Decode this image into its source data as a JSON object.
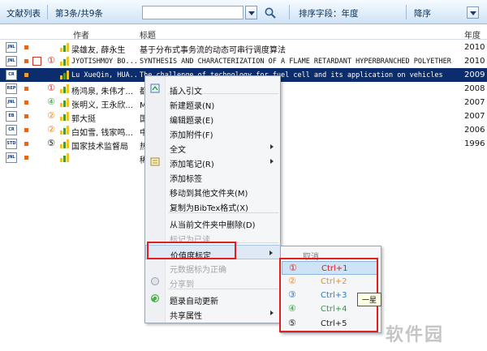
{
  "toolbar": {
    "title": "文献列表",
    "count": "第3条/共9条",
    "sort_label": "排序字段：年度",
    "sort_order": "降序"
  },
  "columns": {
    "author": "作者",
    "title": "标题",
    "year": "年度"
  },
  "rows": [
    {
      "type": "JNL",
      "author": "梁雄友, 薛永生",
      "title": "基于分布式事务流的动态可串行调度算法",
      "year": "2010",
      "rating": "",
      "pdf": false,
      "mono": false
    },
    {
      "type": "JNL",
      "author": "JYOTISHMOY BO...",
      "title": "SYNTHESIS AND CHARACTERIZATION OF A FLAME RETARDANT HYPERBRANCHED POLYETHER",
      "year": "2010",
      "rating": "①",
      "pdf": true,
      "mono": true
    },
    {
      "type": "CR",
      "author": "Lu XueQin, HUA...",
      "title": "The challenge of technology for fuel cell and its application on vehicles",
      "year": "2009",
      "rating": "",
      "pdf": false,
      "mono": true
    },
    {
      "type": "REP",
      "author": "杨鸿泉, 朱伟才...",
      "title": "都...",
      "year": "2008",
      "rating": "①",
      "pdf": false,
      "mono": false
    },
    {
      "type": "JNL",
      "author": "张明义, 王永欣...",
      "title": "Mi...                                                   场模拟",
      "year": "2007",
      "rating": "④",
      "pdf": false,
      "mono": false
    },
    {
      "type": "EB",
      "author": "郭大挺",
      "title": "国...                                                   析研究",
      "year": "2007",
      "rating": "②",
      "pdf": false,
      "mono": false
    },
    {
      "type": "CR",
      "author": "白如雪, 钱家鸣...",
      "title": "中...                                                   与机制的研究",
      "year": "2006",
      "rating": "②",
      "pdf": false,
      "mono": false
    },
    {
      "type": "STD",
      "author": "国家技术监督局",
      "title": "热...",
      "year": "1996",
      "rating": "⑤",
      "pdf": false,
      "mono": false
    },
    {
      "type": "JNL",
      "author": "",
      "title": "稀...",
      "year": "",
      "rating": "",
      "pdf": false,
      "mono": false
    }
  ],
  "context_menu": {
    "items": [
      {
        "label": "插入引文",
        "disabled": false,
        "submenu": false,
        "icon": "quote-icon"
      },
      {
        "label": "新建题录(N)",
        "disabled": false,
        "submenu": false,
        "icon": ""
      },
      {
        "label": "编辑题录(E)",
        "disabled": false,
        "submenu": false,
        "icon": ""
      },
      {
        "label": "添加附件(F)",
        "disabled": false,
        "submenu": false,
        "icon": ""
      },
      {
        "label": "全文",
        "disabled": false,
        "submenu": true,
        "icon": ""
      },
      {
        "label": "添加笔记(R)",
        "disabled": false,
        "submenu": true,
        "icon": "note-icon"
      },
      {
        "label": "添加标签",
        "disabled": false,
        "submenu": false,
        "icon": ""
      },
      {
        "label": "移动到其他文件夹(M)",
        "disabled": false,
        "submenu": false,
        "icon": ""
      },
      {
        "label": "复制为BibTex格式(X)",
        "disabled": false,
        "submenu": false,
        "icon": ""
      },
      {
        "label": "从当前文件夹中删除(D)",
        "disabled": false,
        "submenu": false,
        "icon": ""
      },
      {
        "label": "标记为已读",
        "disabled": true,
        "submenu": false,
        "icon": ""
      },
      {
        "label": "价值度标定",
        "disabled": false,
        "submenu": true,
        "icon": ""
      },
      {
        "label": "元数据标为正确",
        "disabled": true,
        "submenu": false,
        "icon": ""
      },
      {
        "label": "分享到",
        "disabled": true,
        "submenu": false,
        "icon": "share-icon"
      },
      {
        "label": "题录自动更新",
        "disabled": false,
        "submenu": false,
        "icon": "refresh-icon"
      },
      {
        "label": "共享属性",
        "disabled": false,
        "submenu": true,
        "icon": ""
      }
    ]
  },
  "rating_submenu": {
    "cancel": "取消",
    "items": [
      {
        "symbol": "①",
        "shortcut": "Ctrl+1",
        "color": "#d11f1f"
      },
      {
        "symbol": "②",
        "shortcut": "Ctrl+2",
        "color": "#e8892b"
      },
      {
        "symbol": "③",
        "shortcut": "Ctrl+3",
        "color": "#2f78c4"
      },
      {
        "symbol": "④",
        "shortcut": "Ctrl+4",
        "color": "#2e9c3a"
      },
      {
        "symbol": "⑤",
        "shortcut": "Ctrl+5",
        "color": "#222222"
      }
    ]
  },
  "tooltip": "一星",
  "watermark": "软件园",
  "colors": {
    "selected_row": "#0b2d6e",
    "highlight_box": "#e02020",
    "toolbar_bg": "#cfe3f6"
  }
}
